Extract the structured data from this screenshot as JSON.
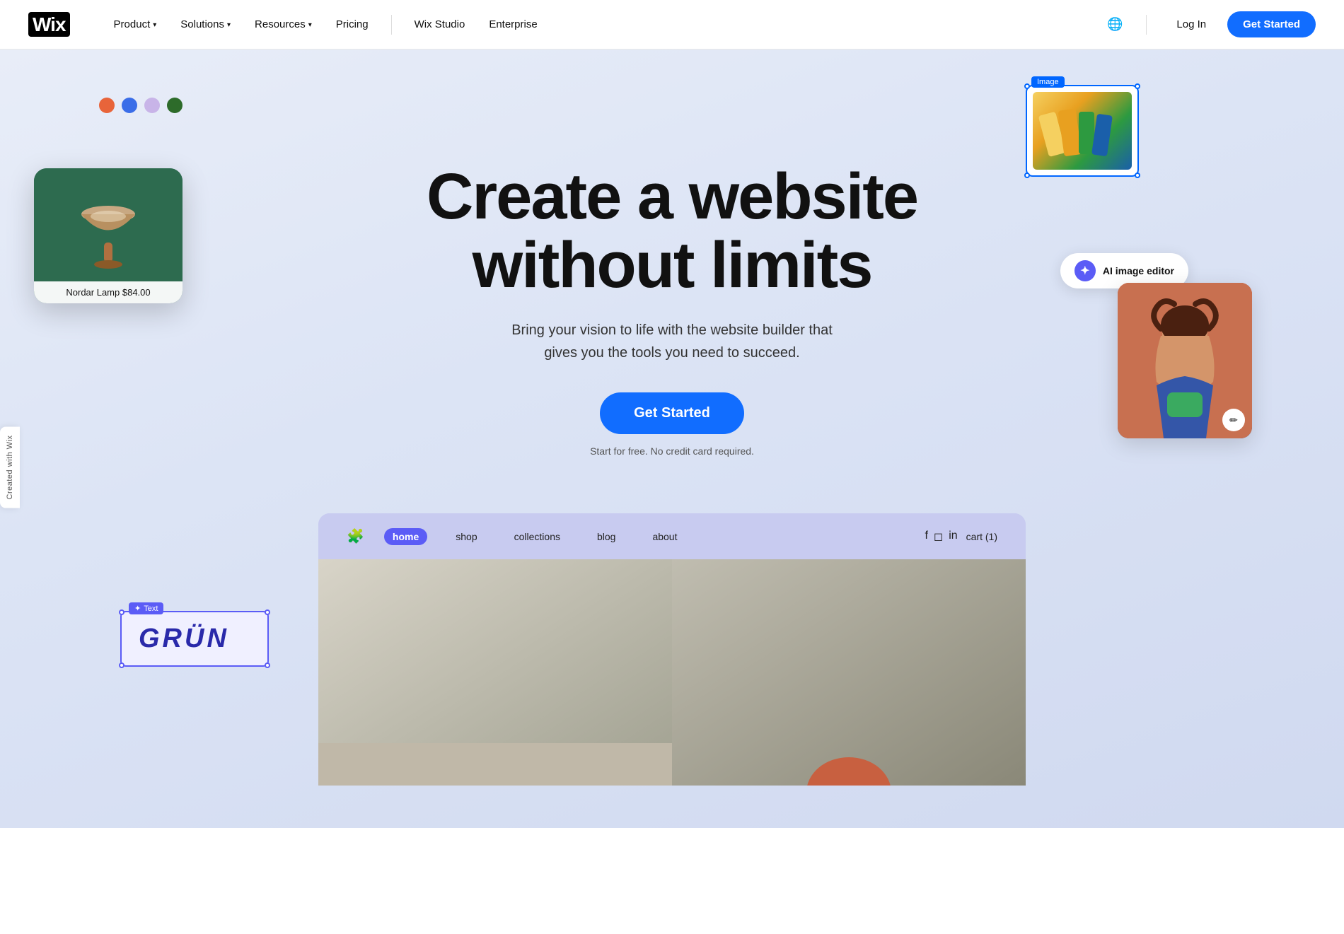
{
  "navbar": {
    "logo": "Wix",
    "links": [
      {
        "id": "product",
        "label": "Product",
        "hasChevron": true
      },
      {
        "id": "solutions",
        "label": "Solutions",
        "hasChevron": true
      },
      {
        "id": "resources",
        "label": "Resources",
        "hasChevron": true
      },
      {
        "id": "pricing",
        "label": "Pricing",
        "hasChevron": false
      },
      {
        "id": "wix-studio",
        "label": "Wix Studio",
        "hasChevron": false
      },
      {
        "id": "enterprise",
        "label": "Enterprise",
        "hasChevron": false
      }
    ],
    "login_label": "Log In",
    "get_started_label": "Get Started"
  },
  "hero": {
    "title_line1": "Create a website",
    "title_line2": "without limits",
    "subtitle": "Bring your vision to life with the website builder that gives you the tools you need to succeed.",
    "cta_button": "Get Started",
    "free_text": "Start for free. No credit card required.",
    "color_dots": [
      "#e8643a",
      "#3a6de8",
      "#c8b4e8",
      "#2d6b2a"
    ],
    "lamp_label": "Nordar Lamp $84.00",
    "image_widget_label": "Image",
    "grun_label": "Text",
    "grun_text": "GRÜN",
    "ai_editor_label": "AI image editor",
    "person_edit_icon": "✏"
  },
  "site_preview": {
    "nav_items": [
      {
        "id": "home",
        "label": "home",
        "active": true
      },
      {
        "id": "shop",
        "label": "shop",
        "active": false
      },
      {
        "id": "collections",
        "label": "collections",
        "active": false
      },
      {
        "id": "blog",
        "label": "blog",
        "active": false
      },
      {
        "id": "about",
        "label": "about",
        "active": false
      }
    ],
    "cart_label": "cart (1)"
  },
  "sidebar": {
    "label": "Created with Wix"
  }
}
